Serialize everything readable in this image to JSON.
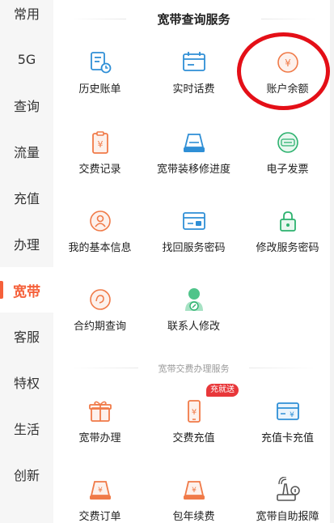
{
  "sidebar": {
    "items": [
      {
        "label": "常用"
      },
      {
        "label": "5G"
      },
      {
        "label": "查询"
      },
      {
        "label": "流量"
      },
      {
        "label": "充值"
      },
      {
        "label": "办理"
      },
      {
        "label": "宽带",
        "active": true
      },
      {
        "label": "客服"
      },
      {
        "label": "特权"
      },
      {
        "label": "生活"
      },
      {
        "label": "创新"
      }
    ]
  },
  "main": {
    "section_title": "宽带查询服务",
    "sub_section_title": "宽带交费办理服务",
    "badge": "充就送",
    "accent_color": "#f5603a",
    "services": [
      {
        "label": "历史账单",
        "icon": "bill-history-icon"
      },
      {
        "label": "实时话费",
        "icon": "realtime-fee-icon"
      },
      {
        "label": "账户余额",
        "icon": "yen-coin-icon"
      },
      {
        "label": "交费记录",
        "icon": "payment-record-icon"
      },
      {
        "label": "宽带装移修进度",
        "icon": "router-icon"
      },
      {
        "label": "电子发票",
        "icon": "e-invoice-icon"
      },
      {
        "label": "我的基本信息",
        "icon": "user-info-icon"
      },
      {
        "label": "找回服务密码",
        "icon": "password-card-icon"
      },
      {
        "label": "修改服务密码",
        "icon": "lock-icon"
      },
      {
        "label": "合约期查询",
        "icon": "contract-icon"
      },
      {
        "label": "联系人修改",
        "icon": "contact-edit-icon"
      }
    ],
    "actions": [
      {
        "label": "宽带办理",
        "icon": "gift-icon"
      },
      {
        "label": "交费充值",
        "icon": "phone-yen-icon"
      },
      {
        "label": "充值卡充值",
        "icon": "recharge-card-icon"
      },
      {
        "label": "交费订单",
        "icon": "order-router-icon"
      },
      {
        "label": "包年续费",
        "icon": "annual-renew-icon"
      },
      {
        "label": "宽带自助报障",
        "icon": "self-repair-icon"
      }
    ]
  }
}
